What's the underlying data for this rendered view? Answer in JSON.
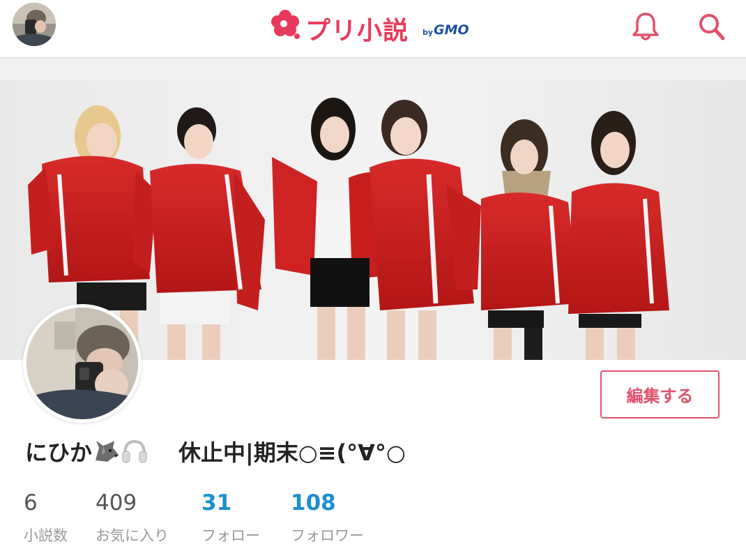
{
  "header": {
    "logo_text": "プリ小説",
    "logo_by": "by",
    "logo_gmo": "GMO",
    "icons": [
      "avatar",
      "bell-icon",
      "search-icon"
    ]
  },
  "profile": {
    "name": "にひか",
    "name_emojis": [
      "wolf-icon",
      "headphones-icon"
    ],
    "status": "休止中|期末○≡(°∀°○",
    "edit_label": "編集する"
  },
  "stats": [
    {
      "value": "6",
      "label": "小説数"
    },
    {
      "value": "409",
      "label": "お気に入り"
    },
    {
      "value": "31",
      "label": "フォロー"
    },
    {
      "value": "108",
      "label": "フォロワー"
    }
  ],
  "colors": {
    "brand": "#e83a5c",
    "gmo": "#1d4f9f",
    "link": "#1c8fd0",
    "edit_border": "#e2506b"
  }
}
